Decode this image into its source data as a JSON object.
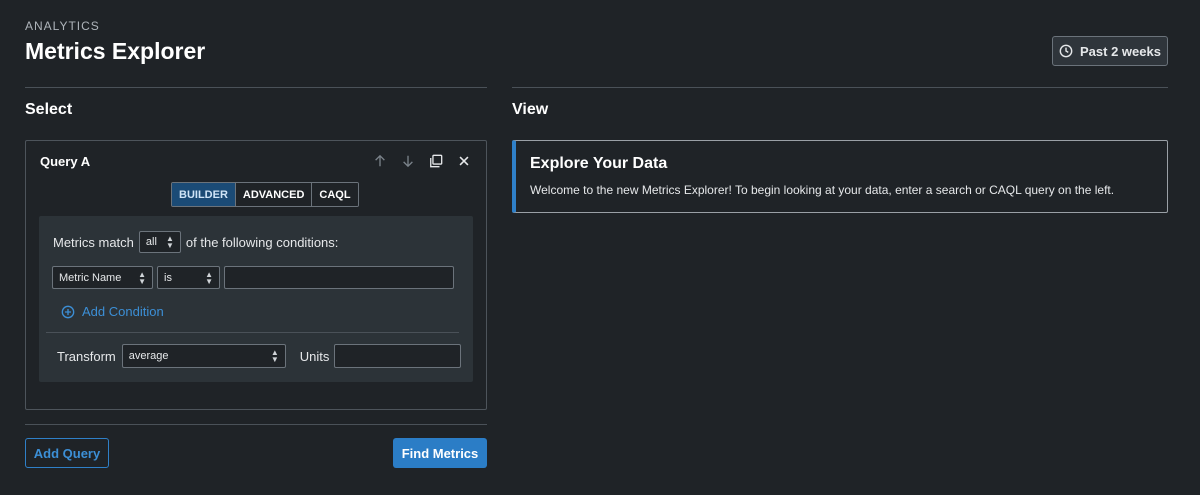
{
  "header": {
    "eyebrow": "ANALYTICS",
    "title": "Metrics Explorer",
    "time_range_label": "Past 2 weeks",
    "time_range_icon": "clock-icon"
  },
  "select_panel": {
    "title": "Select",
    "query": {
      "name": "Query A",
      "tools": [
        "arrow-up-icon",
        "arrow-down-icon",
        "copy-icon",
        "close-icon"
      ],
      "modes": [
        {
          "label": "BUILDER",
          "active": true
        },
        {
          "label": "ADVANCED",
          "active": false
        },
        {
          "label": "CAQL",
          "active": false
        }
      ],
      "builder": {
        "match_prefix": "Metrics match",
        "match_value": "all",
        "match_suffix": "of the following conditions:",
        "condition": {
          "field": "Metric Name",
          "operator": "is",
          "value": ""
        },
        "add_condition_label": "Add Condition",
        "transform_label": "Transform",
        "transform_value": "average",
        "units_label": "Units",
        "units_value": ""
      }
    },
    "add_query_label": "Add Query",
    "find_metrics_label": "Find Metrics"
  },
  "view_panel": {
    "title": "View",
    "card_title": "Explore Your Data",
    "card_text": "Welcome to the new Metrics Explorer! To begin looking at your data, enter a search or CAQL query on the left."
  },
  "colors": {
    "background": "#1f2327",
    "accent": "#2b7dc6",
    "panel": "#2c3338"
  }
}
